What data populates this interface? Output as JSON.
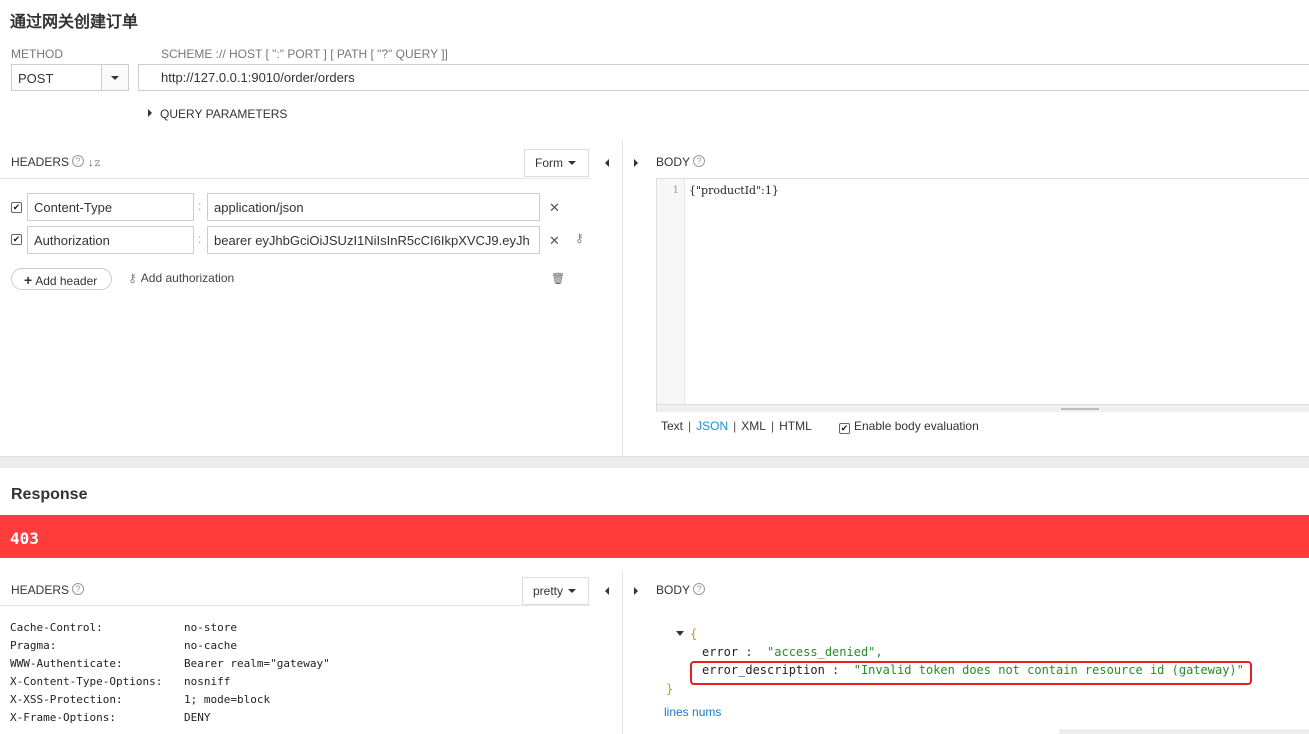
{
  "request": {
    "title": "通过网关创建订单",
    "method_label": "METHOD",
    "scheme_label": "SCHEME :// HOST [ \":\" PORT ] [ PATH [ \"?\" QUERY ]]",
    "method": "POST",
    "url": "http://127.0.0.1:9010/order/orders",
    "query_params_label": "QUERY PARAMETERS",
    "headers_label": "HEADERS",
    "headers_mode": "Form",
    "headers": [
      {
        "name": "Content-Type",
        "value": "application/json",
        "checked": true
      },
      {
        "name": "Authorization",
        "value": "bearer eyJhbGciOiJSUzI1NiIsInR5cCI6IkpXVCJ9.eyJh",
        "checked": true
      }
    ],
    "add_header_label": "Add header",
    "add_authorization_label": "Add authorization",
    "body_label": "BODY",
    "body_line_number": "1",
    "body_code": "{\"productId\":1}",
    "body_formats": [
      "Text",
      "JSON",
      "XML",
      "HTML"
    ],
    "body_format_active": "JSON",
    "body_eval_label": "Enable body evaluation"
  },
  "response": {
    "title": "Response",
    "status_code": "403",
    "status_color": "#ff3b3b",
    "headers_label": "HEADERS",
    "headers_mode": "pretty",
    "body_label": "BODY",
    "headers": [
      {
        "name": "Cache-Control:",
        "value": "no-store"
      },
      {
        "name": "Pragma:",
        "value": "no-cache"
      },
      {
        "name": "WWW-Authenticate:",
        "value": "Bearer realm=\"gateway\""
      },
      {
        "name": "X-Content-Type-Options:",
        "value": "nosniff"
      },
      {
        "name": "X-XSS-Protection:",
        "value": "1; mode=block"
      },
      {
        "name": "X-Frame-Options:",
        "value": "DENY"
      }
    ],
    "body": {
      "open_brace": "{",
      "close_brace": "}",
      "fields": [
        {
          "key": "error",
          "value": "\"access_denied\","
        },
        {
          "key": "error_description",
          "value": "\"Invalid token does not contain resource id (gateway)\""
        }
      ]
    },
    "lines_nums_label": "lines nums"
  }
}
